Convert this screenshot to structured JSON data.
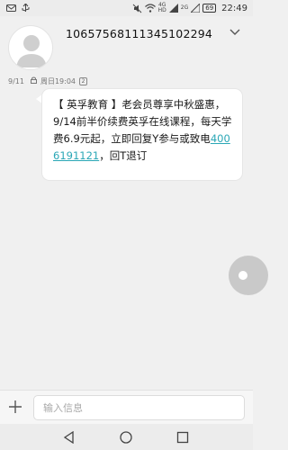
{
  "status_bar": {
    "network_label_top": "4G",
    "network_label_bottom": "HD",
    "network2_label_top": "2G",
    "battery": "69",
    "time": "22:49"
  },
  "header": {
    "phone_number": "10657568111345102294"
  },
  "message": {
    "date": "9/11",
    "timestamp": "周日19:04",
    "sim_slot": "2",
    "text_before_link": "【 英孚教育 】老会员尊享中秋盛惠，9/14前半价续费英孚在线课程，每天学费6.9元起，立即回复Y参与或致电",
    "phone_link": "4006191121",
    "text_after_link": "，回T退订"
  },
  "compose": {
    "placeholder": "输入信息"
  },
  "colors": {
    "link": "#2aa7b6",
    "background": "#f0f0f0",
    "bubble": "#ffffff"
  }
}
